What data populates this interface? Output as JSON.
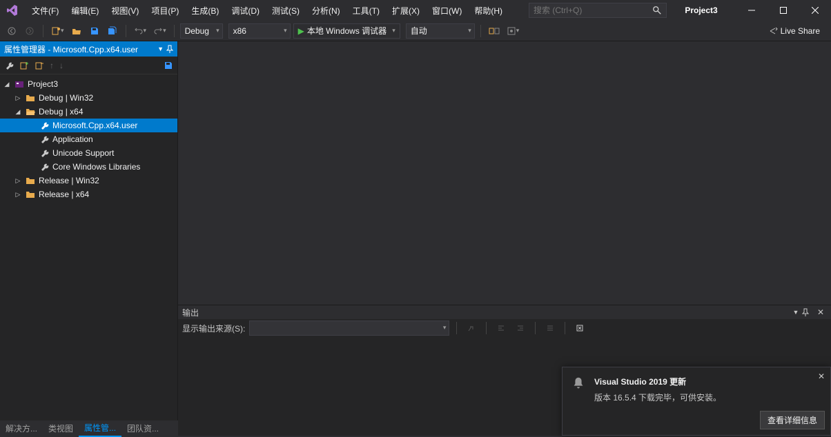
{
  "menus": [
    "文件(F)",
    "编辑(E)",
    "视图(V)",
    "项目(P)",
    "生成(B)",
    "调试(D)",
    "测试(S)",
    "分析(N)",
    "工具(T)",
    "扩展(X)",
    "窗口(W)",
    "帮助(H)"
  ],
  "search_placeholder": "搜索 (Ctrl+Q)",
  "project_title": "Project3",
  "toolbar": {
    "config": "Debug",
    "platform": "x86",
    "run_label": "本地 Windows 调试器",
    "auto": "自动"
  },
  "live_share": "Live Share",
  "panel_title": "属性管理器 - Microsoft.Cpp.x64.user",
  "tree": {
    "root": "Project3",
    "items": [
      {
        "label": "Debug | Win32",
        "expanded": false
      },
      {
        "label": "Debug | x64",
        "expanded": true,
        "children": [
          {
            "label": "Microsoft.Cpp.x64.user",
            "selected": true
          },
          {
            "label": "Application"
          },
          {
            "label": "Unicode Support"
          },
          {
            "label": "Core Windows Libraries"
          }
        ]
      },
      {
        "label": "Release | Win32",
        "expanded": false
      },
      {
        "label": "Release | x64",
        "expanded": false
      }
    ]
  },
  "output": {
    "title": "输出",
    "source_label": "显示输出来源(S):"
  },
  "bottom_tabs": [
    "解决方...",
    "类视图",
    "属性管...",
    "团队资..."
  ],
  "bottom_active": 2,
  "notification": {
    "title": "Visual Studio 2019 更新",
    "text": "版本 16.5.4 下载完毕，可供安装。",
    "button": "查看详细信息"
  }
}
